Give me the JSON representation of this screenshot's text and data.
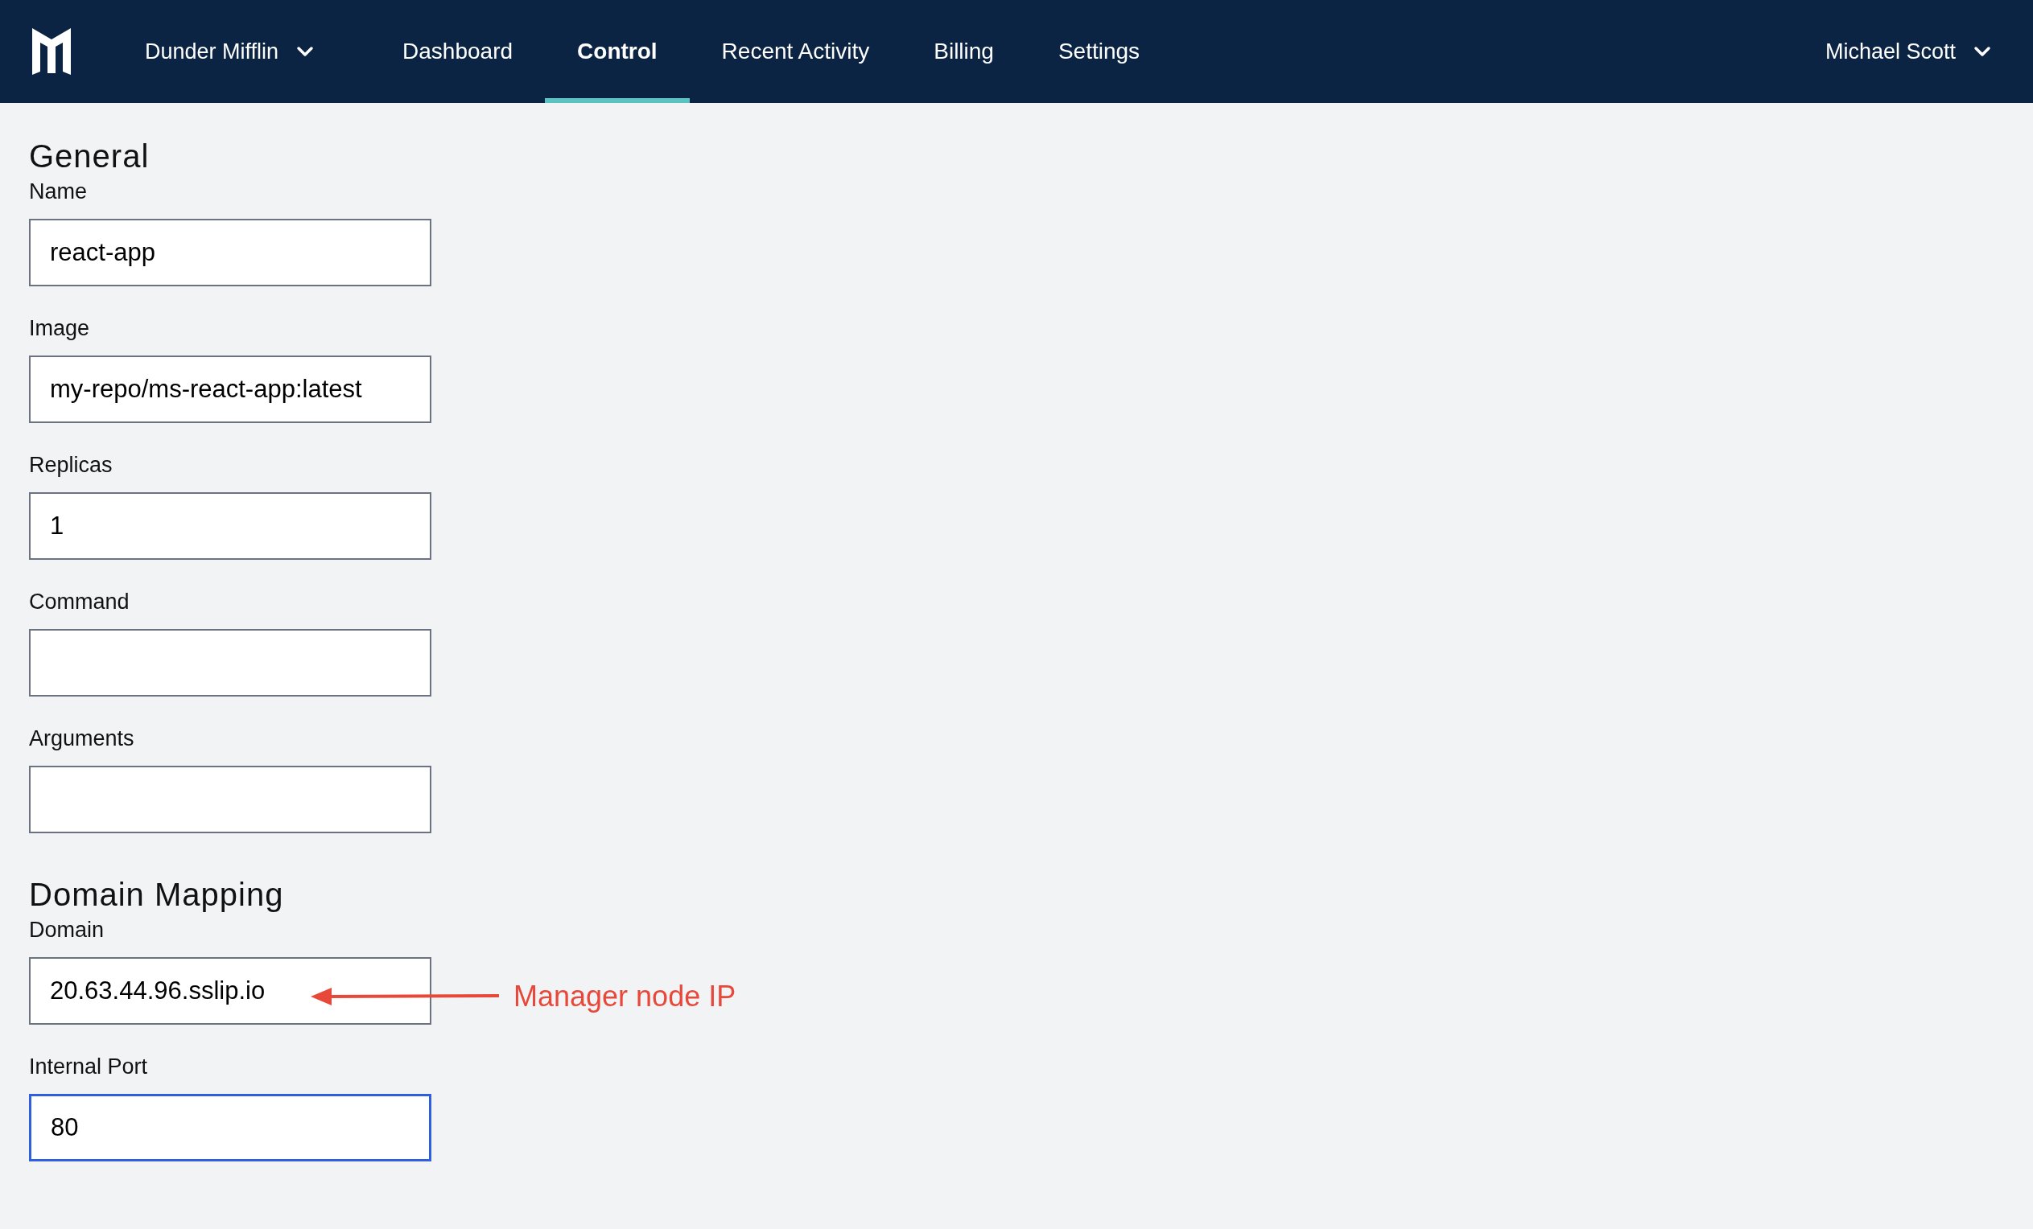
{
  "nav": {
    "org": "Dunder Mifflin",
    "tabs": [
      {
        "label": "Dashboard",
        "selected": false
      },
      {
        "label": "Control",
        "selected": true
      },
      {
        "label": "Recent Activity",
        "selected": false
      },
      {
        "label": "Billing",
        "selected": false
      },
      {
        "label": "Settings",
        "selected": false
      }
    ],
    "user": "Michael Scott"
  },
  "sections": [
    {
      "title": "General",
      "fields": [
        {
          "label": "Name",
          "value": "react-app",
          "focused": false
        },
        {
          "label": "Image",
          "value": "my-repo/ms-react-app:latest",
          "focused": false
        },
        {
          "label": "Replicas",
          "value": "1",
          "focused": false
        },
        {
          "label": "Command",
          "focused": false
        },
        {
          "label": "Arguments",
          "focused": false
        }
      ]
    },
    {
      "title": "Domain Mapping",
      "fields": [
        {
          "label": "Domain",
          "value": "20.63.44.96.sslip.io",
          "focused": false,
          "annotation": "Manager node IP"
        },
        {
          "label": "Internal Port",
          "value": "80",
          "focused": true
        }
      ]
    }
  ]
}
